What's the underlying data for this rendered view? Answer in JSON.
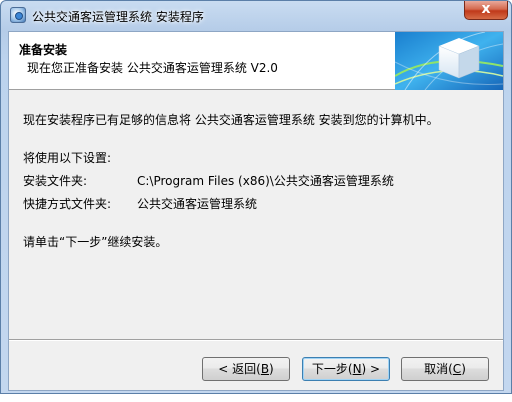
{
  "window": {
    "title": "公共交通客运管理系统 安装程序",
    "close_glyph": "x"
  },
  "header": {
    "title": "准备安装",
    "subtitle": "现在您正准备安装 公共交通客运管理系统  V2.0"
  },
  "body": {
    "intro": "现在安装程序已有足够的信息将 公共交通客运管理系统 安装到您的计算机中。",
    "settings_heading": "将使用以下设置:",
    "install_folder_label": "安装文件夹:",
    "install_folder_value": "C:\\Program Files (x86)\\公共交通客运管理系统",
    "shortcut_folder_label": "快捷方式文件夹:",
    "shortcut_folder_value": "公共交通客运管理系统",
    "instruction": "请单击“下一步”继续安装。"
  },
  "buttons": {
    "back": {
      "prefix": "< 返回(",
      "key": "B",
      "suffix": ")"
    },
    "next": {
      "prefix": "下一步(",
      "key": "N",
      "suffix": ") >"
    },
    "cancel": {
      "prefix": "取消(",
      "key": "C",
      "suffix": ")"
    }
  },
  "icons": {
    "app": "installer-app-icon",
    "close": "close-icon",
    "header_art": "cube-globe-banner"
  },
  "colors": {
    "title_bar": "#bcd3ee",
    "close_button": "#c0391a",
    "dialog_bg": "#f0f0f0",
    "header_bg": "#ffffff",
    "default_button_border": "#3c7fb1"
  }
}
